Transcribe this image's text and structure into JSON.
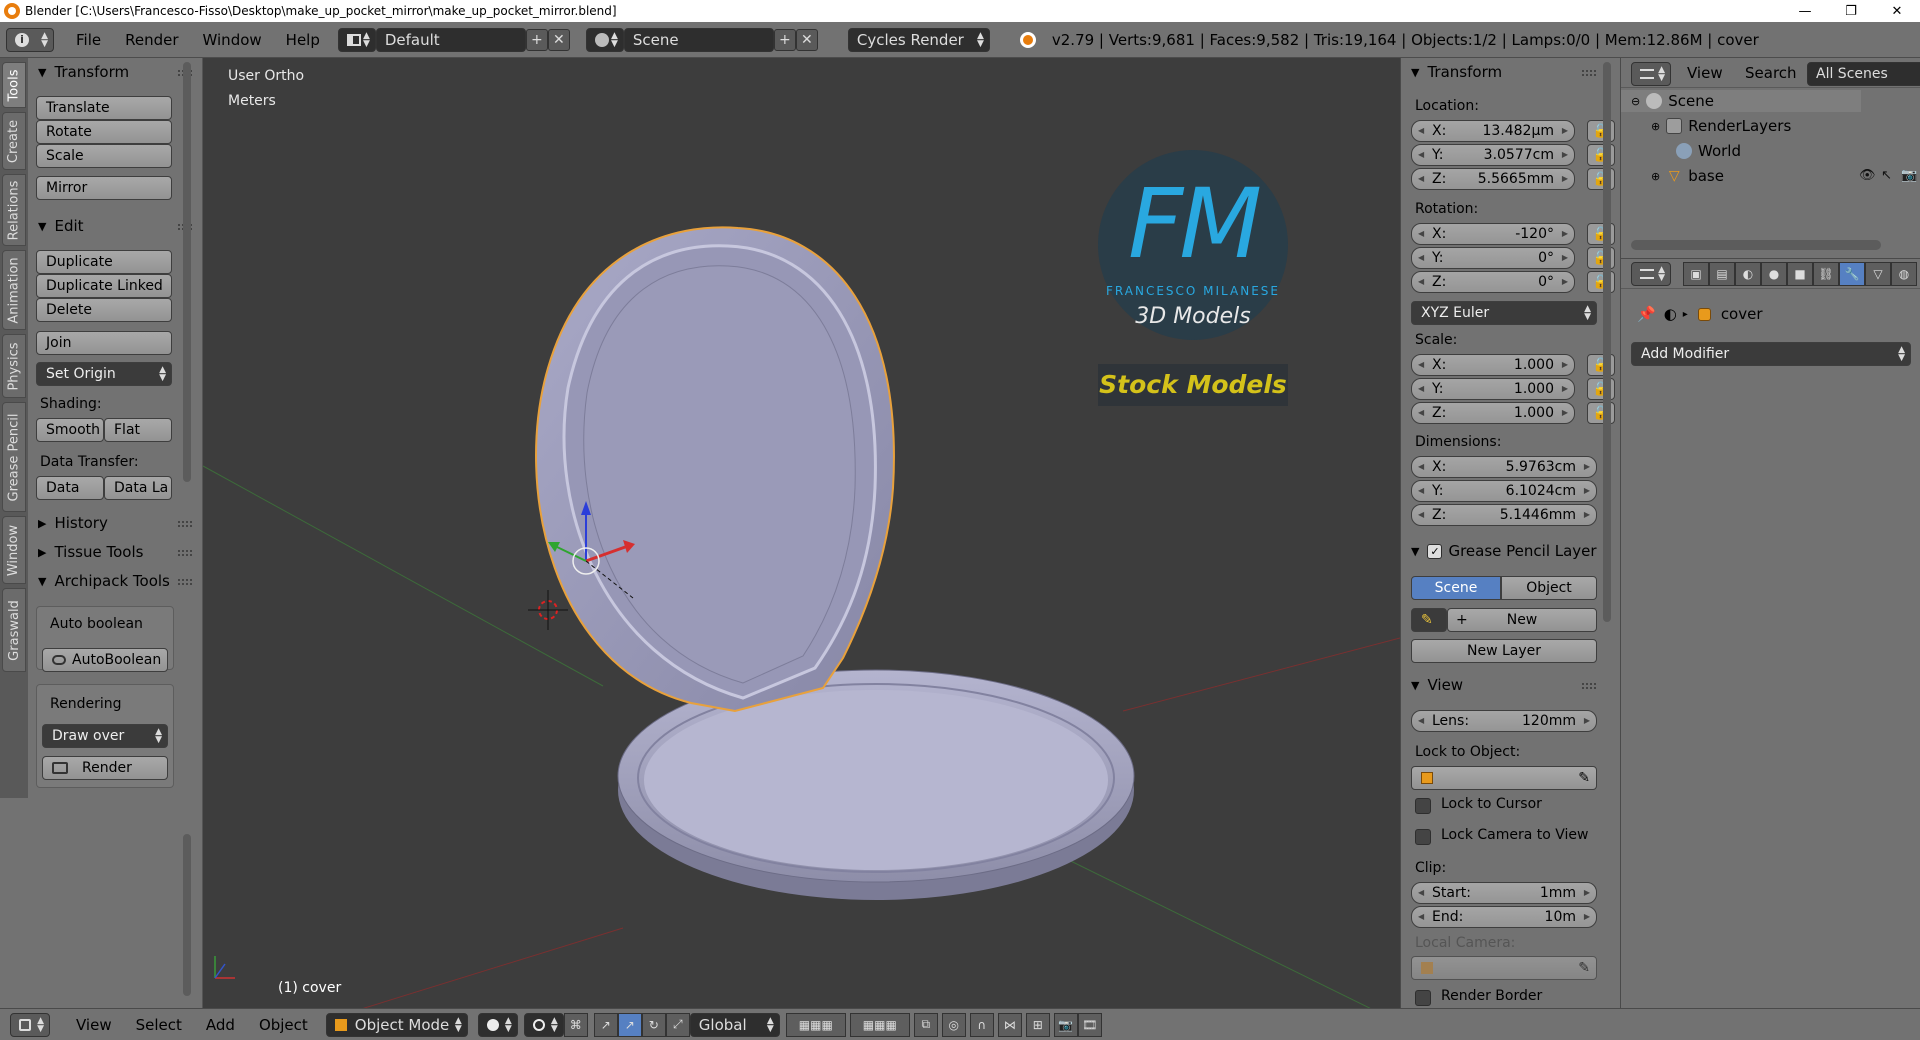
{
  "window": {
    "title": "Blender [C:\\Users\\Francesco-Fisso\\Desktop\\make_up_pocket_mirror\\make_up_pocket_mirror.blend]",
    "minimize": "—",
    "maximize": "❐",
    "close": "✕"
  },
  "infobar": {
    "menus": [
      "File",
      "Render",
      "Window",
      "Help"
    ],
    "screen_layout": "Default",
    "scene": "Scene",
    "render_engine": "Cycles Render",
    "stats": "v2.79 | Verts:9,681 | Faces:9,582 | Tris:19,164 | Objects:1/2 | Lamps:0/0 | Mem:12.86M | cover"
  },
  "left_tabs": [
    "Tools",
    "Create",
    "Relations",
    "Animation",
    "Physics",
    "Grease Pencil",
    "Window",
    "Graswald"
  ],
  "toolshelf": {
    "transform_header": "Transform",
    "translate": "Translate",
    "rotate": "Rotate",
    "scale": "Scale",
    "mirror": "Mirror",
    "edit_header": "Edit",
    "duplicate": "Duplicate",
    "duplicate_linked": "Duplicate Linked",
    "delete": "Delete",
    "join": "Join",
    "set_origin": "Set Origin",
    "shading_label": "Shading:",
    "smooth": "Smooth",
    "flat": "Flat",
    "data_transfer_label": "Data Transfer:",
    "data": "Data",
    "data_layout": "Data La",
    "history_header": "History",
    "tissue_header": "Tissue Tools",
    "archipack_header": "Archipack Tools",
    "auto_boolean_label": "Auto boolean",
    "autoboolean_button": "AutoBoolean",
    "rendering_label": "Rendering",
    "draw_over": "Draw over",
    "render_button": "Render"
  },
  "viewport": {
    "view_name": "User Ortho",
    "units": "Meters",
    "object_label": "(1) cover",
    "watermark": {
      "line1": "FM",
      "line2": "FRANCESCO MILANESE",
      "line3": "3D Models",
      "banner": "Stock Models"
    }
  },
  "npanel": {
    "transform_header": "Transform",
    "location_label": "Location:",
    "location": [
      {
        "axis": "X:",
        "value": "13.482µm"
      },
      {
        "axis": "Y:",
        "value": "3.0577cm"
      },
      {
        "axis": "Z:",
        "value": "5.5665mm"
      }
    ],
    "rotation_label": "Rotation:",
    "rotation": [
      {
        "axis": "X:",
        "value": "-120°"
      },
      {
        "axis": "Y:",
        "value": "0°"
      },
      {
        "axis": "Z:",
        "value": "0°"
      }
    ],
    "rotation_mode": "XYZ Euler",
    "scale_label": "Scale:",
    "scale": [
      {
        "axis": "X:",
        "value": "1.000"
      },
      {
        "axis": "Y:",
        "value": "1.000"
      },
      {
        "axis": "Z:",
        "value": "1.000"
      }
    ],
    "dimensions_label": "Dimensions:",
    "dimensions": [
      {
        "axis": "X:",
        "value": "5.9763cm"
      },
      {
        "axis": "Y:",
        "value": "6.1024cm"
      },
      {
        "axis": "Z:",
        "value": "5.1446mm"
      }
    ],
    "grease_header": "Grease Pencil Layer",
    "scene_tab": "Scene",
    "object_tab": "Object",
    "new_button": "New",
    "new_layer_button": "New Layer",
    "view_header": "View",
    "lens_label": "Lens:",
    "lens_value": "120mm",
    "lock_to_object_label": "Lock to Object:",
    "lock_to_cursor": "Lock to Cursor",
    "lock_camera_to_view": "Lock Camera to View",
    "clip_label": "Clip:",
    "clip_start_label": "Start:",
    "clip_start_value": "1mm",
    "clip_end_label": "End:",
    "clip_end_value": "10m",
    "local_camera_label": "Local Camera:",
    "render_border": "Render Border"
  },
  "outliner": {
    "view": "View",
    "search": "Search",
    "all_scenes": "All Scenes",
    "items": [
      "Scene",
      "RenderLayers",
      "World",
      "base"
    ]
  },
  "properties": {
    "object_name": "cover",
    "add_modifier": "Add Modifier"
  },
  "bottombar": {
    "view": "View",
    "select": "Select",
    "add": "Add",
    "object": "Object",
    "mode": "Object Mode",
    "orientation": "Global"
  },
  "colors": {
    "panel": "#727272",
    "viewport_bg": "#3d3d3d",
    "mesh": "#9999b8",
    "selection": "#e8a13c",
    "accent_blue": "#5680c2",
    "watermark_blue": "#29a8e0",
    "watermark_yellow": "#d4c21a"
  }
}
